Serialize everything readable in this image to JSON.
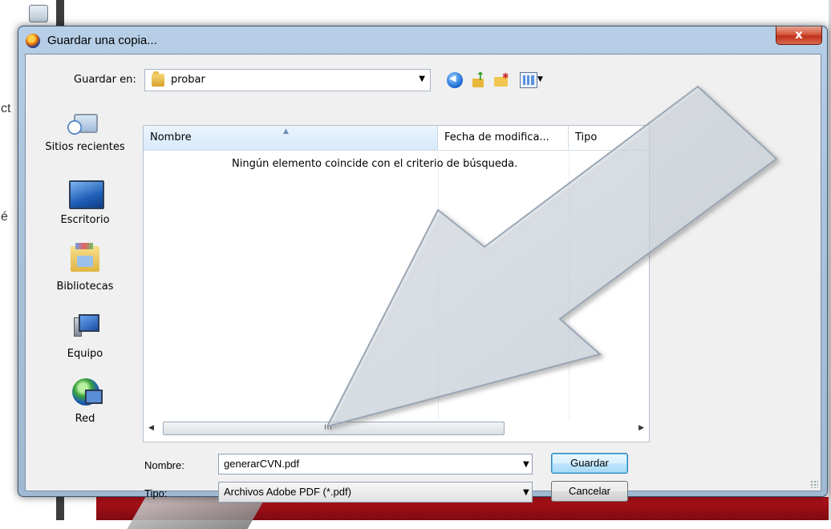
{
  "background": {
    "left_letters": [
      "ct",
      "é"
    ]
  },
  "dialog": {
    "title": "Guardar una copia...",
    "close_label": "x",
    "save_in_label": "Guardar en:",
    "current_folder": "probar",
    "toolbar_icons": [
      "back-icon",
      "up-folder-icon",
      "new-folder-icon",
      "views-menu-icon"
    ]
  },
  "places": [
    {
      "label": "Sitios recientes",
      "icon": "recent-places-icon"
    },
    {
      "label": "Escritorio",
      "icon": "desktop-icon"
    },
    {
      "label": "Bibliotecas",
      "icon": "libraries-icon"
    },
    {
      "label": "Equipo",
      "icon": "computer-icon"
    },
    {
      "label": "Red",
      "icon": "network-icon"
    }
  ],
  "filelist": {
    "columns": [
      "Nombre",
      "Fecha de modifica...",
      "Tipo"
    ],
    "empty_message": "Ningún elemento coincide con el criterio de búsqueda.",
    "scroll_grip": "III"
  },
  "form": {
    "name_label": "Nombre:",
    "name_value": "generarCVN.pdf",
    "type_label": "Tipo:",
    "type_value": "Archivos Adobe PDF (*.pdf)"
  },
  "buttons": {
    "save": "Guardar",
    "cancel": "Cancelar"
  },
  "colors": {
    "title_bar": "#b7cfe6",
    "close_button": "#c0301a",
    "default_button_border": "#3c7fb1",
    "background_red": "#b3121a"
  }
}
